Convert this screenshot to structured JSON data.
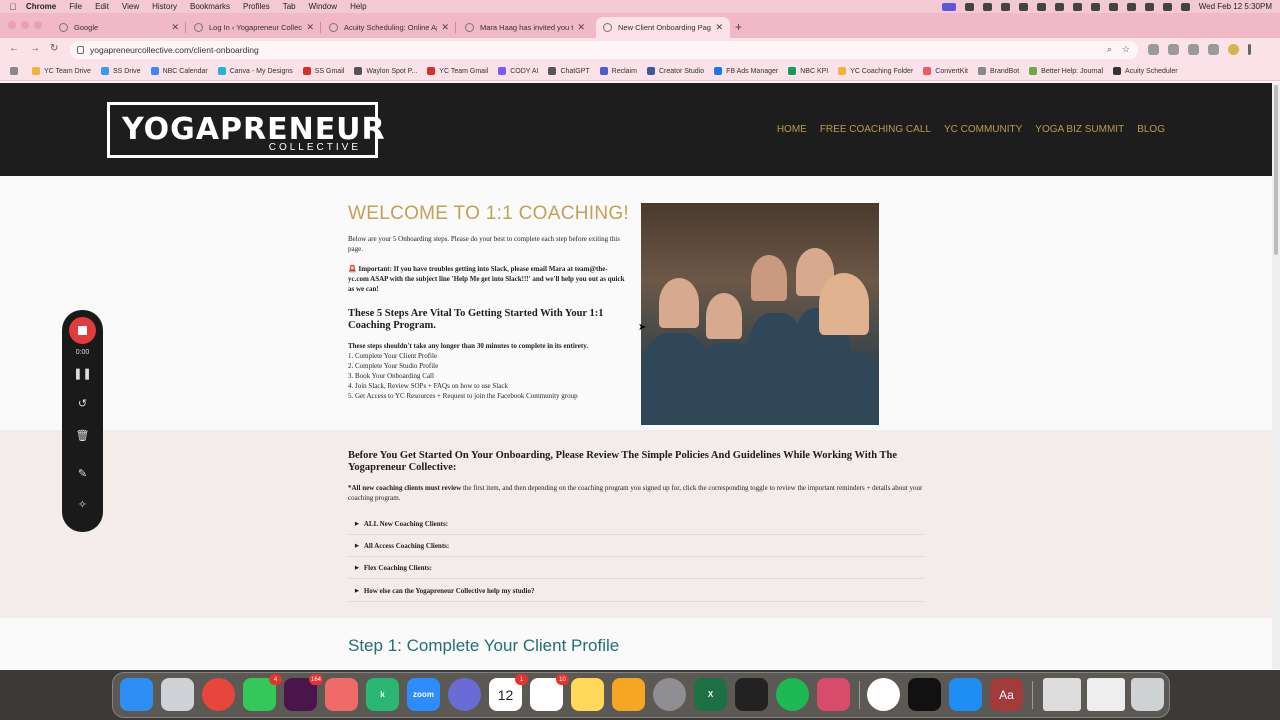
{
  "menubar": {
    "app": "Chrome",
    "items": [
      "File",
      "Edit",
      "View",
      "History",
      "Bookmarks",
      "Profiles",
      "Tab",
      "Window",
      "Help"
    ],
    "clock": "Wed Feb 12  5:30PM"
  },
  "tabs": [
    {
      "title": "Google"
    },
    {
      "title": "Log In ‹ Yogapreneur Collecti"
    },
    {
      "title": "Acuity Scheduling: Online Ap"
    },
    {
      "title": "Mara Haag has invited you to"
    },
    {
      "title": "New Client Onboarding Page"
    }
  ],
  "address": {
    "url": "yogapreneurcollective.com/client-onboarding"
  },
  "bookmarks": [
    {
      "label": "YC Team Drive",
      "color": "#f1b43a"
    },
    {
      "label": "SS Drive",
      "color": "#3a9bf1"
    },
    {
      "label": "NBC Calendar",
      "color": "#4285f4"
    },
    {
      "label": "Canva - My Designs",
      "color": "#23b5d3"
    },
    {
      "label": "SS Gmail",
      "color": "#d93025"
    },
    {
      "label": "Waylon Spot P...",
      "color": "#555555"
    },
    {
      "label": "YC Team Gmail",
      "color": "#d93025"
    },
    {
      "label": "CODY AI",
      "color": "#7a5af8"
    },
    {
      "label": "ChatGPT",
      "color": "#555555"
    },
    {
      "label": "Reclaim",
      "color": "#4a5bd4"
    },
    {
      "label": "Creator Studio",
      "color": "#3b5998"
    },
    {
      "label": "FB Ads Manager",
      "color": "#1877f2"
    },
    {
      "label": "NBC KPI",
      "color": "#0f9d58"
    },
    {
      "label": "YC Coaching Folder",
      "color": "#f1b43a"
    },
    {
      "label": "ConvertKit",
      "color": "#e85a6a"
    },
    {
      "label": "BrandBot",
      "color": "#888888"
    },
    {
      "label": "Better Help: Journal",
      "color": "#6aa84f"
    },
    {
      "label": "Acuity Scheduler",
      "color": "#333333"
    }
  ],
  "site": {
    "logo_main": "YOGAPRENEUR",
    "logo_sub": "COLLECTIVE",
    "nav": [
      "HOME",
      "FREE COACHING CALL",
      "YC COMMUNITY",
      "YOGA BIZ SUMMIT",
      "BLOG"
    ]
  },
  "content": {
    "welcome": "WELCOME TO 1:1 COACHING!",
    "intro": "Below are your 5 Onboarding steps. Please do your best to complete each step before exiting this page.",
    "important": "🚨 Important: If you have troubles getting into Slack, please email Mara at team@the-yc.com ASAP with the subject line 'Help Me get into Slack!!!' and we'll help you out as quick as we can!",
    "steps_heading": "These 5 Steps Are Vital To Getting Started With Your 1:1 Coaching Program.",
    "steps_note": "These steps shouldn't take any longer than 30 minutes to complete in its entirety.",
    "steps": [
      "1. Complete Your Client Profile",
      "2. Complete Your Studio Profile",
      "3. Book Your Onboarding Call",
      "4. Join Slack, Review SOPs + FAQs on how to use Slack",
      "5. Get Access to YC Resources + Request to join the Facebook Community group"
    ],
    "policies_heading": "Before You Get Started On Your Onboarding, Please Review The Simple Policies And Guidelines While Working With The Yogapreneur Collective:",
    "policies_bold": "*All new coaching clients must review",
    "policies_text": " the first item, and then depending on the coaching program you signed up for, click the corresponding toggle to review the important reminders + details about your coaching program.",
    "accordions": [
      "ALL New Coaching Clients:",
      "All Access Coaching Clients:",
      "Flex Coaching Clients:",
      "How else can the Yogapreneur Collective help my studio?"
    ],
    "step1_heading": "Step 1: Complete Your Client Profile"
  },
  "recorder": {
    "time": "0:00"
  },
  "dock": [
    {
      "name": "finder",
      "color": "#2f8ef5",
      "label": ""
    },
    {
      "name": "launchpad",
      "color": "#ffffff",
      "label": ""
    },
    {
      "name": "chrome",
      "color": "#e8453c",
      "label": ""
    },
    {
      "name": "messages",
      "color": "#34c759",
      "label": "",
      "badge": "4"
    },
    {
      "name": "slack",
      "color": "#4a154b",
      "label": "",
      "badge": "164"
    },
    {
      "name": "asana",
      "color": "#f06a6a",
      "label": ""
    },
    {
      "name": "kajabi",
      "color": "#2bb673",
      "label": "k"
    },
    {
      "name": "zoom",
      "color": "#2d8cff",
      "label": "zoom"
    },
    {
      "name": "settings-gear",
      "color": "#6b6bd6",
      "label": ""
    },
    {
      "name": "calendar",
      "color": "#ffffff",
      "label": "12",
      "badge": "1"
    },
    {
      "name": "reminders",
      "color": "#ffffff",
      "label": "",
      "badge": "10"
    },
    {
      "name": "notes",
      "color": "#ffd95a",
      "label": ""
    },
    {
      "name": "photos",
      "color": "#f5a623",
      "label": ""
    },
    {
      "name": "system-settings",
      "color": "#8e8e93",
      "label": ""
    },
    {
      "name": "excel",
      "color": "#1d7044",
      "label": "X"
    },
    {
      "name": "activity-monitor",
      "color": "#222222",
      "label": ""
    },
    {
      "name": "spotify",
      "color": "#1db954",
      "label": ""
    },
    {
      "name": "iphone-mirroring",
      "color": "#d94b6a",
      "label": ""
    },
    {
      "name": "chatgpt",
      "color": "#ffffff",
      "label": ""
    },
    {
      "name": "capcut",
      "color": "#111111",
      "label": ""
    },
    {
      "name": "app-store",
      "color": "#1e8ef5",
      "label": ""
    },
    {
      "name": "dictionary",
      "color": "#a33b3b",
      "label": "Aa"
    },
    {
      "name": "window-preview-1",
      "color": "#dddddd",
      "label": ""
    },
    {
      "name": "window-preview-2",
      "color": "#eeeeee",
      "label": ""
    },
    {
      "name": "trash",
      "color": "#cfd3d6",
      "label": ""
    }
  ]
}
